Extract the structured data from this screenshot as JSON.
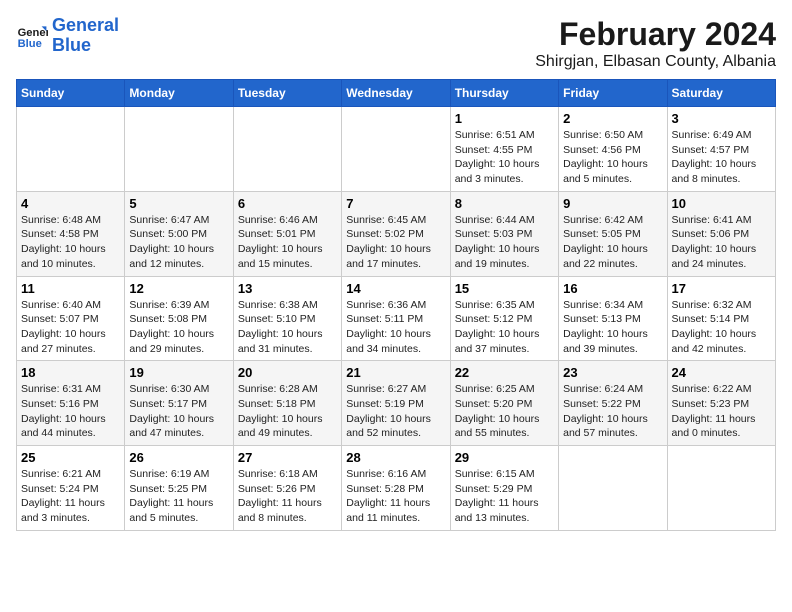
{
  "header": {
    "logo_line1": "General",
    "logo_line2": "Blue",
    "title": "February 2024",
    "subtitle": "Shirgjan, Elbasan County, Albania"
  },
  "weekdays": [
    "Sunday",
    "Monday",
    "Tuesday",
    "Wednesday",
    "Thursday",
    "Friday",
    "Saturday"
  ],
  "weeks": [
    [
      {
        "day": "",
        "info": ""
      },
      {
        "day": "",
        "info": ""
      },
      {
        "day": "",
        "info": ""
      },
      {
        "day": "",
        "info": ""
      },
      {
        "day": "1",
        "info": "Sunrise: 6:51 AM\nSunset: 4:55 PM\nDaylight: 10 hours and 3 minutes."
      },
      {
        "day": "2",
        "info": "Sunrise: 6:50 AM\nSunset: 4:56 PM\nDaylight: 10 hours and 5 minutes."
      },
      {
        "day": "3",
        "info": "Sunrise: 6:49 AM\nSunset: 4:57 PM\nDaylight: 10 hours and 8 minutes."
      }
    ],
    [
      {
        "day": "4",
        "info": "Sunrise: 6:48 AM\nSunset: 4:58 PM\nDaylight: 10 hours and 10 minutes."
      },
      {
        "day": "5",
        "info": "Sunrise: 6:47 AM\nSunset: 5:00 PM\nDaylight: 10 hours and 12 minutes."
      },
      {
        "day": "6",
        "info": "Sunrise: 6:46 AM\nSunset: 5:01 PM\nDaylight: 10 hours and 15 minutes."
      },
      {
        "day": "7",
        "info": "Sunrise: 6:45 AM\nSunset: 5:02 PM\nDaylight: 10 hours and 17 minutes."
      },
      {
        "day": "8",
        "info": "Sunrise: 6:44 AM\nSunset: 5:03 PM\nDaylight: 10 hours and 19 minutes."
      },
      {
        "day": "9",
        "info": "Sunrise: 6:42 AM\nSunset: 5:05 PM\nDaylight: 10 hours and 22 minutes."
      },
      {
        "day": "10",
        "info": "Sunrise: 6:41 AM\nSunset: 5:06 PM\nDaylight: 10 hours and 24 minutes."
      }
    ],
    [
      {
        "day": "11",
        "info": "Sunrise: 6:40 AM\nSunset: 5:07 PM\nDaylight: 10 hours and 27 minutes."
      },
      {
        "day": "12",
        "info": "Sunrise: 6:39 AM\nSunset: 5:08 PM\nDaylight: 10 hours and 29 minutes."
      },
      {
        "day": "13",
        "info": "Sunrise: 6:38 AM\nSunset: 5:10 PM\nDaylight: 10 hours and 31 minutes."
      },
      {
        "day": "14",
        "info": "Sunrise: 6:36 AM\nSunset: 5:11 PM\nDaylight: 10 hours and 34 minutes."
      },
      {
        "day": "15",
        "info": "Sunrise: 6:35 AM\nSunset: 5:12 PM\nDaylight: 10 hours and 37 minutes."
      },
      {
        "day": "16",
        "info": "Sunrise: 6:34 AM\nSunset: 5:13 PM\nDaylight: 10 hours and 39 minutes."
      },
      {
        "day": "17",
        "info": "Sunrise: 6:32 AM\nSunset: 5:14 PM\nDaylight: 10 hours and 42 minutes."
      }
    ],
    [
      {
        "day": "18",
        "info": "Sunrise: 6:31 AM\nSunset: 5:16 PM\nDaylight: 10 hours and 44 minutes."
      },
      {
        "day": "19",
        "info": "Sunrise: 6:30 AM\nSunset: 5:17 PM\nDaylight: 10 hours and 47 minutes."
      },
      {
        "day": "20",
        "info": "Sunrise: 6:28 AM\nSunset: 5:18 PM\nDaylight: 10 hours and 49 minutes."
      },
      {
        "day": "21",
        "info": "Sunrise: 6:27 AM\nSunset: 5:19 PM\nDaylight: 10 hours and 52 minutes."
      },
      {
        "day": "22",
        "info": "Sunrise: 6:25 AM\nSunset: 5:20 PM\nDaylight: 10 hours and 55 minutes."
      },
      {
        "day": "23",
        "info": "Sunrise: 6:24 AM\nSunset: 5:22 PM\nDaylight: 10 hours and 57 minutes."
      },
      {
        "day": "24",
        "info": "Sunrise: 6:22 AM\nSunset: 5:23 PM\nDaylight: 11 hours and 0 minutes."
      }
    ],
    [
      {
        "day": "25",
        "info": "Sunrise: 6:21 AM\nSunset: 5:24 PM\nDaylight: 11 hours and 3 minutes."
      },
      {
        "day": "26",
        "info": "Sunrise: 6:19 AM\nSunset: 5:25 PM\nDaylight: 11 hours and 5 minutes."
      },
      {
        "day": "27",
        "info": "Sunrise: 6:18 AM\nSunset: 5:26 PM\nDaylight: 11 hours and 8 minutes."
      },
      {
        "day": "28",
        "info": "Sunrise: 6:16 AM\nSunset: 5:28 PM\nDaylight: 11 hours and 11 minutes."
      },
      {
        "day": "29",
        "info": "Sunrise: 6:15 AM\nSunset: 5:29 PM\nDaylight: 11 hours and 13 minutes."
      },
      {
        "day": "",
        "info": ""
      },
      {
        "day": "",
        "info": ""
      }
    ]
  ]
}
